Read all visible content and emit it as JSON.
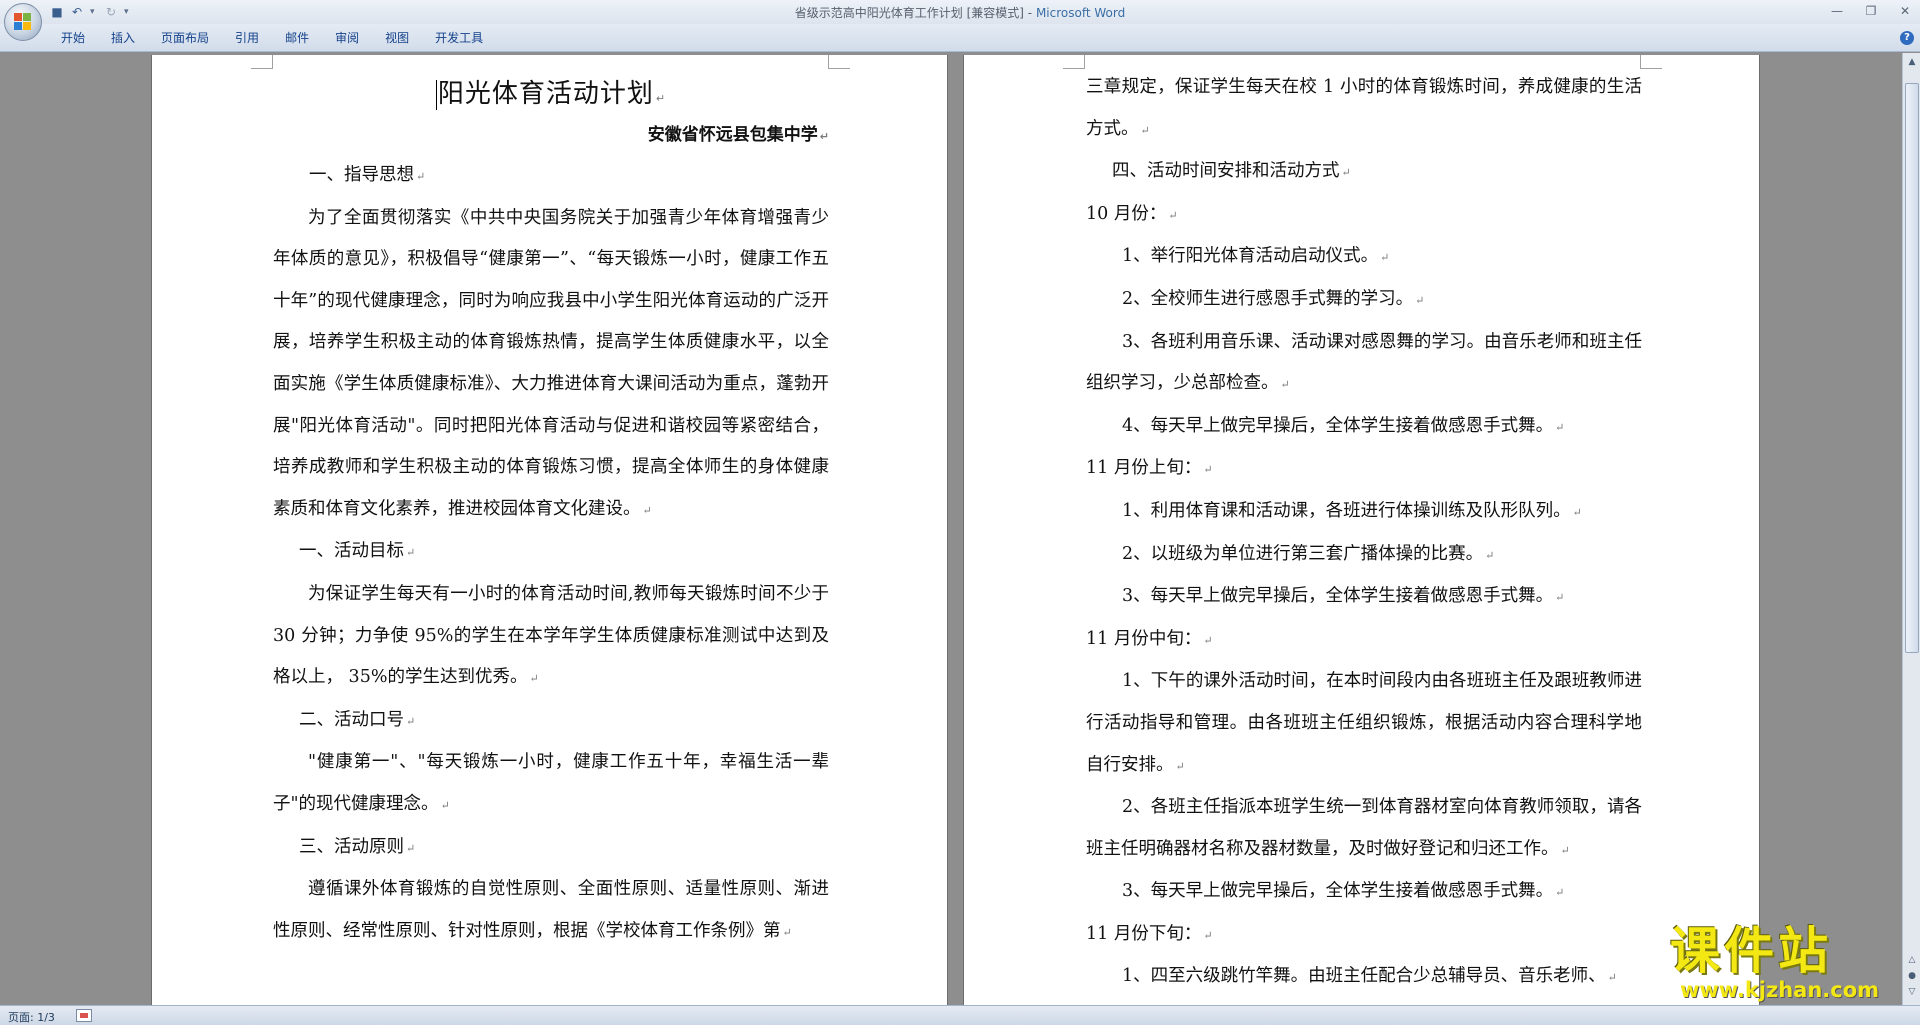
{
  "window": {
    "title": "省级示范高中阳光体育工作计划 [兼容模式]",
    "app_name": "Microsoft Word"
  },
  "quick_access": {
    "save_icon": "save-icon",
    "undo_icon": "undo-icon",
    "redo_icon": "redo-icon"
  },
  "ribbon": {
    "tabs": [
      "开始",
      "插入",
      "页面布局",
      "引用",
      "邮件",
      "审阅",
      "视图",
      "开发工具"
    ]
  },
  "page1": {
    "title": "阳光体育活动计划",
    "subtitle": "安徽省怀远县包集中学",
    "paragraphs": [
      {
        "text": "一、指导思想",
        "style": "h1"
      },
      {
        "text": "为了全面贯彻落实《中共中央国务院关于加强青少年体育增强青少年体质的意见》，积极倡导“健康第一”、“每天锻炼一小时，健康工作五十年”的现代健康理念，同时为响应我县中小学生阳光体育运动的广泛开展，培养学生积极主动的体育锻炼热情，提高学生体质健康水平，以全面实施《学生体质健康标准》、大力推进体育大课间活动为重点，蓬勃开展\"阳光体育活动\"。同时把阳光体育活动与促进和谐校园等紧密结合，培养成教师和学生积极主动的体育锻炼习惯，提高全体师生的身体健康素质和体育文化素养，推进校园体育文化建设。",
        "style": "body"
      },
      {
        "text": "一、活动目标",
        "style": "h2"
      },
      {
        "text": "为保证学生每天有一小时的体育活动时间,教师每天锻炼时间不少于 30 分钟；力争使 95%的学生在本学年学生体质健康标准测试中达到及格以上， 35%的学生达到优秀。",
        "style": "body"
      },
      {
        "text": "二、活动口号",
        "style": "h2"
      },
      {
        "text": "\"健康第一\"、\"每天锻炼一小时，健康工作五十年，幸福生活一辈子\"的现代健康理念。",
        "style": "body"
      },
      {
        "text": "三、活动原则",
        "style": "h2"
      },
      {
        "text": "遵循课外体育锻炼的自觉性原则、全面性原则、适量性原则、渐进性原则、经常性原则、针对性原则，根据《学校体育工作条例》第",
        "style": "body"
      }
    ]
  },
  "page2": {
    "paragraphs": [
      {
        "text": "三章规定，保证学生每天在校 1 小时的体育锻炼时间，养成健康的生活方式。",
        "style": "noind"
      },
      {
        "text": "四、活动时间安排和活动方式",
        "style": "h2"
      },
      {
        "text": "10 月份：",
        "style": "noind"
      },
      {
        "text": "1、举行阳光体育活动启动仪式。",
        "style": "item"
      },
      {
        "text": "2、全校师生进行感恩手式舞的学习。",
        "style": "item"
      },
      {
        "text": "3、各班利用音乐课、活动课对感恩舞的学习。由音乐老师和班主任组织学习，少总部检查。",
        "style": "item"
      },
      {
        "text": "4、每天早上做完早操后，全体学生接着做感恩手式舞。",
        "style": "item"
      },
      {
        "text": "11 月份上旬：",
        "style": "noind"
      },
      {
        "text": "1、利用体育课和活动课，各班进行体操训练及队形队列。",
        "style": "item"
      },
      {
        "text": "2、以班级为单位进行第三套广播体操的比赛。",
        "style": "item"
      },
      {
        "text": "3、每天早上做完早操后，全体学生接着做感恩手式舞。",
        "style": "item"
      },
      {
        "text": "11 月份中旬：",
        "style": "noind"
      },
      {
        "text": "1、下午的课外活动时间，在本时间段内由各班班主任及跟班教师进行活动指导和管理。由各班班主任组织锻炼，根据活动内容合理科学地自行安排。",
        "style": "item"
      },
      {
        "text": "2、各班主任指派本班学生统一到体育器材室向体育教师领取，请各班主任明确器材名称及器材数量，及时做好登记和归还工作。",
        "style": "item"
      },
      {
        "text": "3、每天早上做完早操后，全体学生接着做感恩手式舞。",
        "style": "item"
      },
      {
        "text": "11 月份下旬：",
        "style": "noind"
      },
      {
        "text": "1、四至六级跳竹竿舞。由班主任配合少总辅导员、音乐老师、",
        "style": "item"
      }
    ]
  },
  "statusbar": {
    "page_indicator": "页面: 1/3"
  },
  "watermark": {
    "title": "课件站",
    "url": "www.kjzhan.com"
  },
  "colors": {
    "ribbon_text": "#15428b",
    "app_name": "#3a6ea5",
    "watermark": "#f3e813",
    "background": "#8e8e8e"
  }
}
